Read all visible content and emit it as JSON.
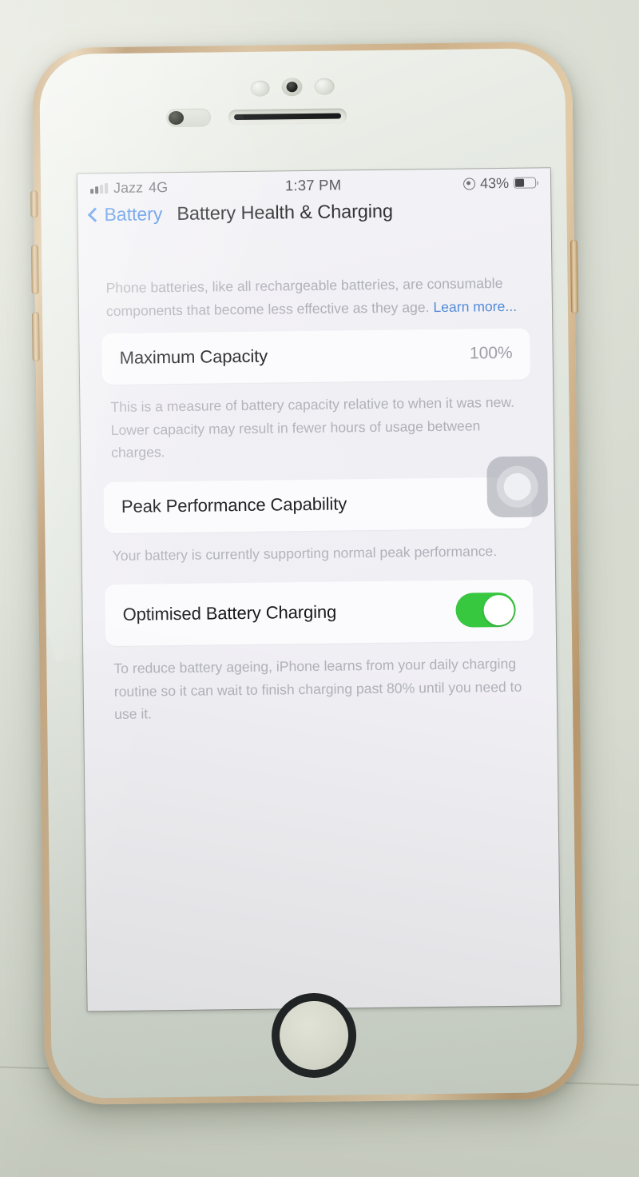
{
  "status_bar": {
    "carrier": "Jazz",
    "network": "4G",
    "time": "1:37 PM",
    "battery_percent": "43%",
    "signal_bars_filled": 2,
    "signal_bars_total": 4,
    "location_icon": "location-services-icon",
    "battery_icon": "battery-icon"
  },
  "nav": {
    "back_label": "Battery",
    "title": "Battery Health & Charging",
    "back_icon": "chevron-left-icon",
    "accent_color": "#2f7ce0"
  },
  "intro": {
    "text": "Phone batteries, like all rechargeable batteries, are consumable components that become less effective as they age. ",
    "link_label": "Learn more..."
  },
  "maximum_capacity": {
    "label": "Maximum Capacity",
    "value": "100%",
    "footer": "This is a measure of battery capacity relative to when it was new. Lower capacity may result in fewer hours of usage between charges."
  },
  "peak_performance": {
    "label": "Peak Performance Capability",
    "footer": "Your battery is currently supporting normal peak performance."
  },
  "optimised_charging": {
    "label": "Optimised Battery Charging",
    "toggle_state": "on",
    "toggle_color": "#38c840",
    "footer": "To reduce battery ageing, iPhone learns from your daily charging routine so it can wait to finish charging past 80% until you need to use it."
  },
  "overlay": {
    "assistive_touch": "assistive-touch-button"
  },
  "device": {
    "home_button": "home-button",
    "front_camera": "front-camera-icon",
    "earpiece": "earpiece-speaker",
    "buttons": [
      "mute-switch",
      "volume-up-button",
      "volume-down-button",
      "power-button"
    ]
  }
}
